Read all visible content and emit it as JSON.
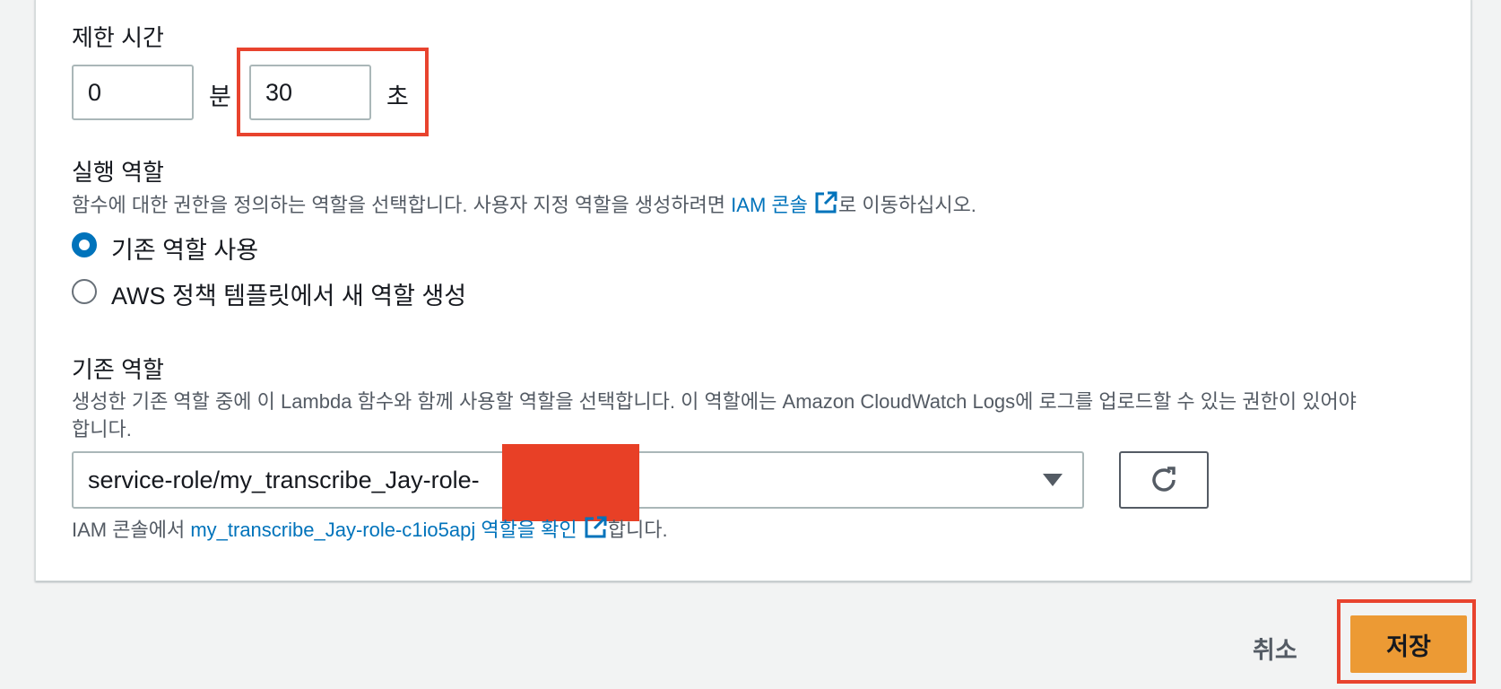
{
  "timeout": {
    "label": "제한 시간",
    "minutes_value": "0",
    "minutes_unit": "분",
    "seconds_value": "30",
    "seconds_unit": "초"
  },
  "execution_role": {
    "label": "실행 역할",
    "description_pre": "함수에 대한 권한을 정의하는 역할을 선택합니다. 사용자 지정 역할을 생성하려면 ",
    "description_link": "IAM 콘솔",
    "description_post": "로 이동하십시오.",
    "options": [
      {
        "label": "기존 역할 사용",
        "selected": true
      },
      {
        "label": "AWS 정책 템플릿에서 새 역할 생성",
        "selected": false
      }
    ]
  },
  "existing_role": {
    "label": "기존 역할",
    "description_line1": "생성한 기존 역할 중에 이 Lambda 함수와 함께 사용할 역할을 선택합니다. 이 역할에는 Amazon CloudWatch Logs에 로그를 업로드할 수 있는 권한이 있어야",
    "description_line2": "합니다.",
    "selected_value": "service-role/my_transcribe_Jay-role-",
    "footer_pre": "IAM 콘솔에서 ",
    "footer_link": "my_transcribe_Jay-role-c1io5apj 역할을 확인",
    "footer_post": "합니다."
  },
  "actions": {
    "cancel_label": "취소",
    "save_label": "저장"
  },
  "colors": {
    "accent": "#0073bb",
    "primary_button": "#ec9a34",
    "annotation_red": "#e8432e"
  }
}
